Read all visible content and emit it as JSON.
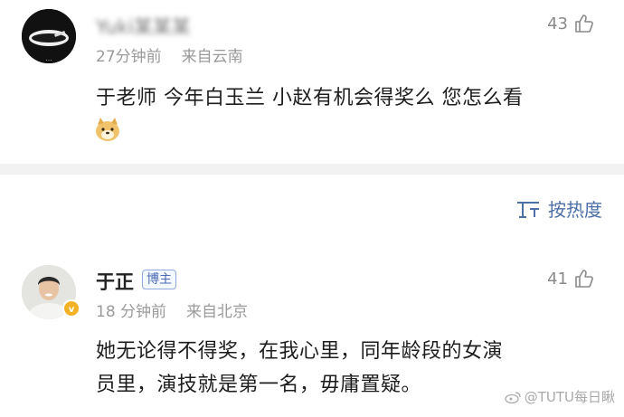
{
  "comments": [
    {
      "author": "Yuki某某某",
      "time": "27分钟前",
      "source": "来自云南",
      "likes": "43",
      "text": "于老师 今年白玉兰 小赵有机会得奖么 您怎么看",
      "emoji": "doge-emoji"
    },
    {
      "author": "于正",
      "badge": "博主",
      "time": "18 分钟前",
      "source": "来自北京",
      "likes": "41",
      "text_line1": "她无论得不得奖，在我心里，同年龄段的女演",
      "text_line2": "员里，演技就是第一名，毋庸置疑。"
    }
  ],
  "sort": {
    "label": "按热度",
    "icon": "sort-icon"
  },
  "watermark": "@TUTU每日瞅",
  "icons": {
    "like": "thumbs-up-icon",
    "verified": "verified-badge-icon"
  },
  "colors": {
    "accent": "#4d6fa8",
    "meta": "#9a9a9a",
    "divider": "#f2f2f2",
    "verified": "#f3b126"
  }
}
